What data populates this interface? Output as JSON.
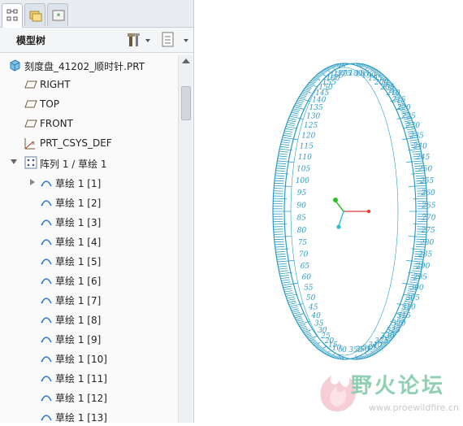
{
  "panel": {
    "header_title": "模型树",
    "tree": [
      {
        "label": "刻度盘_41202_顺时针.PRT",
        "icon": "part-icon"
      },
      {
        "label": "RIGHT",
        "icon": "datum-plane-icon"
      },
      {
        "label": "TOP",
        "icon": "datum-plane-icon"
      },
      {
        "label": "FRONT",
        "icon": "datum-plane-icon"
      },
      {
        "label": "PRT_CSYS_DEF",
        "icon": "coordinate-system-icon"
      },
      {
        "label": "阵列 1 / 草绘 1",
        "icon": "pattern-icon",
        "expanded": true
      },
      {
        "label": "草绘 1 [1]",
        "icon": "sketch-icon",
        "collapsed": true
      },
      {
        "label": "草绘 1 [2]",
        "icon": "sketch-icon"
      },
      {
        "label": "草绘 1 [3]",
        "icon": "sketch-icon"
      },
      {
        "label": "草绘 1 [4]",
        "icon": "sketch-icon"
      },
      {
        "label": "草绘 1 [5]",
        "icon": "sketch-icon"
      },
      {
        "label": "草绘 1 [6]",
        "icon": "sketch-icon"
      },
      {
        "label": "草绘 1 [7]",
        "icon": "sketch-icon"
      },
      {
        "label": "草绘 1 [8]",
        "icon": "sketch-icon"
      },
      {
        "label": "草绘 1 [9]",
        "icon": "sketch-icon"
      },
      {
        "label": "草绘 1 [10]",
        "icon": "sketch-icon"
      },
      {
        "label": "草绘 1 [11]",
        "icon": "sketch-icon"
      },
      {
        "label": "草绘 1 [12]",
        "icon": "sketch-icon"
      },
      {
        "label": "草绘 1 [13]",
        "icon": "sketch-icon"
      }
    ]
  },
  "viewport": {
    "dial_color": "#2a9cc7",
    "left_ticks": [
      "0",
      "5",
      "10",
      "15",
      "20",
      "25",
      "30",
      "35",
      "40",
      "45",
      "50",
      "55",
      "60",
      "65",
      "70",
      "75",
      "80",
      "85",
      "90",
      "95",
      "100",
      "105",
      "110",
      "115",
      "120",
      "125",
      "130",
      "135",
      "140",
      "145",
      "150",
      "155",
      "160",
      "165",
      "170",
      "175"
    ],
    "right_ticks": [
      "180",
      "185",
      "190",
      "195",
      "200",
      "205",
      "210",
      "215",
      "220",
      "225",
      "230",
      "235",
      "240",
      "245",
      "250",
      "255",
      "260",
      "265",
      "270",
      "275",
      "280",
      "285",
      "290",
      "295",
      "300",
      "305",
      "310",
      "315",
      "320",
      "325",
      "330",
      "335",
      "340",
      "345",
      "350",
      "355"
    ]
  },
  "watermark": {
    "title": "野火论坛",
    "url": "www.proewildfire.cn"
  },
  "colors": {
    "accent": "#2a9cc7",
    "axis_x": "#e23b3b",
    "axis_y": "#28c228",
    "axis_z": "#2bbbd6",
    "watermark": "#8fd0b4"
  }
}
